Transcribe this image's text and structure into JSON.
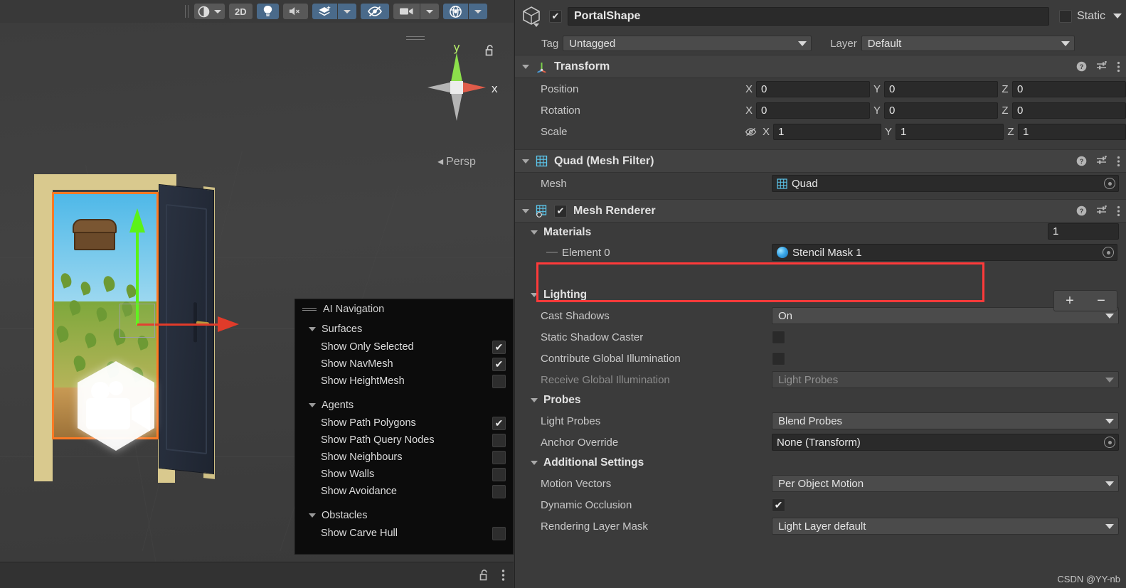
{
  "scene": {
    "toolbar": {
      "buttons": [
        {
          "name": "shading-mode",
          "icon": "sphere-half-icon",
          "label": "",
          "active": false,
          "has_caret": true
        },
        {
          "name": "2d-toggle",
          "icon": "",
          "label": "2D",
          "active": false,
          "has_caret": false
        },
        {
          "name": "scene-lighting",
          "icon": "lightbulb-icon",
          "label": "",
          "active": true,
          "has_caret": false
        },
        {
          "name": "scene-audio",
          "icon": "speaker-mute-icon",
          "label": "",
          "active": false,
          "has_caret": false
        },
        {
          "name": "fx-effects",
          "icon": "layers-sparkle-icon",
          "label": "",
          "active": true,
          "has_caret": true
        },
        {
          "name": "scene-visibility",
          "icon": "eye-slash-icon",
          "label": "",
          "active": true,
          "has_caret": false
        },
        {
          "name": "camera-settings",
          "icon": "camera-icon",
          "label": "",
          "active": false,
          "has_caret": true
        },
        {
          "name": "gizmos-toggle",
          "icon": "gizmo-globe-icon",
          "label": "",
          "active": true,
          "has_caret": true
        }
      ]
    },
    "gizmo": {
      "axis_y_label": "y",
      "axis_x_label": "x",
      "projection_label": "Persp",
      "lock_icon": "unlocked-padlock-icon"
    },
    "bottom_bar": {
      "lock_icon": "unlocked-padlock-icon",
      "menu_icon": "kebab-menu-icon"
    }
  },
  "ai_navigation": {
    "title": "AI Navigation",
    "sections": [
      {
        "name": "Surfaces",
        "rows": [
          {
            "label": "Show Only Selected",
            "checked": true
          },
          {
            "label": "Show NavMesh",
            "checked": true
          },
          {
            "label": "Show HeightMesh",
            "checked": false
          }
        ]
      },
      {
        "name": "Agents",
        "rows": [
          {
            "label": "Show Path Polygons",
            "checked": true
          },
          {
            "label": "Show Path Query Nodes",
            "checked": false
          },
          {
            "label": "Show Neighbours",
            "checked": false
          },
          {
            "label": "Show Walls",
            "checked": false
          },
          {
            "label": "Show Avoidance",
            "checked": false
          }
        ]
      },
      {
        "name": "Obstacles",
        "rows": [
          {
            "label": "Show Carve Hull",
            "checked": false
          }
        ]
      }
    ]
  },
  "inspector": {
    "object": {
      "icon": "cube-gameobject-icon",
      "enabled": true,
      "name": "PortalShape",
      "static_label": "Static",
      "static_checked": false,
      "tag_label": "Tag",
      "tag_value": "Untagged",
      "layer_label": "Layer",
      "layer_value": "Default"
    },
    "components": [
      {
        "id": "transform",
        "title": "Transform",
        "icon": "transform-axes-icon",
        "expanded": true,
        "has_toggle": false,
        "help_icon": "help-question-icon",
        "preset_icon": "preset-sliders-icon",
        "menu_icon": "kebab-menu-icon",
        "rows": [
          {
            "label": "Position",
            "x": "0",
            "y": "0",
            "z": "0",
            "has_eye": false
          },
          {
            "label": "Rotation",
            "x": "0",
            "y": "0",
            "z": "0",
            "has_eye": false
          },
          {
            "label": "Scale",
            "x": "1",
            "y": "1",
            "z": "1",
            "has_eye": true,
            "eye_icon": "eye-slash-icon"
          }
        ],
        "axis_labels": [
          "X",
          "Y",
          "Z"
        ]
      },
      {
        "id": "mesh-filter",
        "title": "Quad (Mesh Filter)",
        "icon": "mesh-grid-icon",
        "expanded": true,
        "has_toggle": false,
        "mesh_label": "Mesh",
        "mesh_value": "Quad",
        "mesh_value_icon": "mesh-grid-icon"
      },
      {
        "id": "mesh-renderer",
        "title": "Mesh Renderer",
        "icon": "mesh-renderer-icon",
        "expanded": true,
        "has_toggle": true,
        "enabled": true
      }
    ],
    "materials": {
      "foldout_label": "Materials",
      "size_value": "1",
      "element_label": "Element 0",
      "element_value": "Stencil Mask 1",
      "element_icon": "material-sphere-icon",
      "add_button": "+",
      "remove_button": "−",
      "highlight_color": "#ff3a3a"
    },
    "lighting": {
      "foldout_label": "Lighting",
      "rows": [
        {
          "label": "Cast Shadows",
          "type": "dropdown",
          "value": "On",
          "disabled": false
        },
        {
          "label": "Static Shadow Caster",
          "type": "checkbox",
          "checked": false,
          "disabled": false
        },
        {
          "label": "Contribute Global Illumination",
          "type": "checkbox",
          "checked": false,
          "disabled": false
        },
        {
          "label": "Receive Global Illumination",
          "type": "dropdown",
          "value": "Light Probes",
          "disabled": true
        }
      ]
    },
    "probes": {
      "foldout_label": "Probes",
      "rows": [
        {
          "label": "Light Probes",
          "type": "dropdown",
          "value": "Blend Probes",
          "disabled": false
        },
        {
          "label": "Anchor Override",
          "type": "object",
          "value": "None (Transform)",
          "disabled": false
        }
      ]
    },
    "additional_settings": {
      "foldout_label": "Additional Settings",
      "rows": [
        {
          "label": "Motion Vectors",
          "type": "dropdown",
          "value": "Per Object Motion",
          "disabled": false
        },
        {
          "label": "Dynamic Occlusion",
          "type": "checkbox",
          "checked": true,
          "disabled": false
        },
        {
          "label": "Rendering Layer Mask",
          "type": "dropdown",
          "value": "Light Layer default",
          "disabled": false
        }
      ]
    }
  },
  "watermark": "CSDN @YY-nb"
}
